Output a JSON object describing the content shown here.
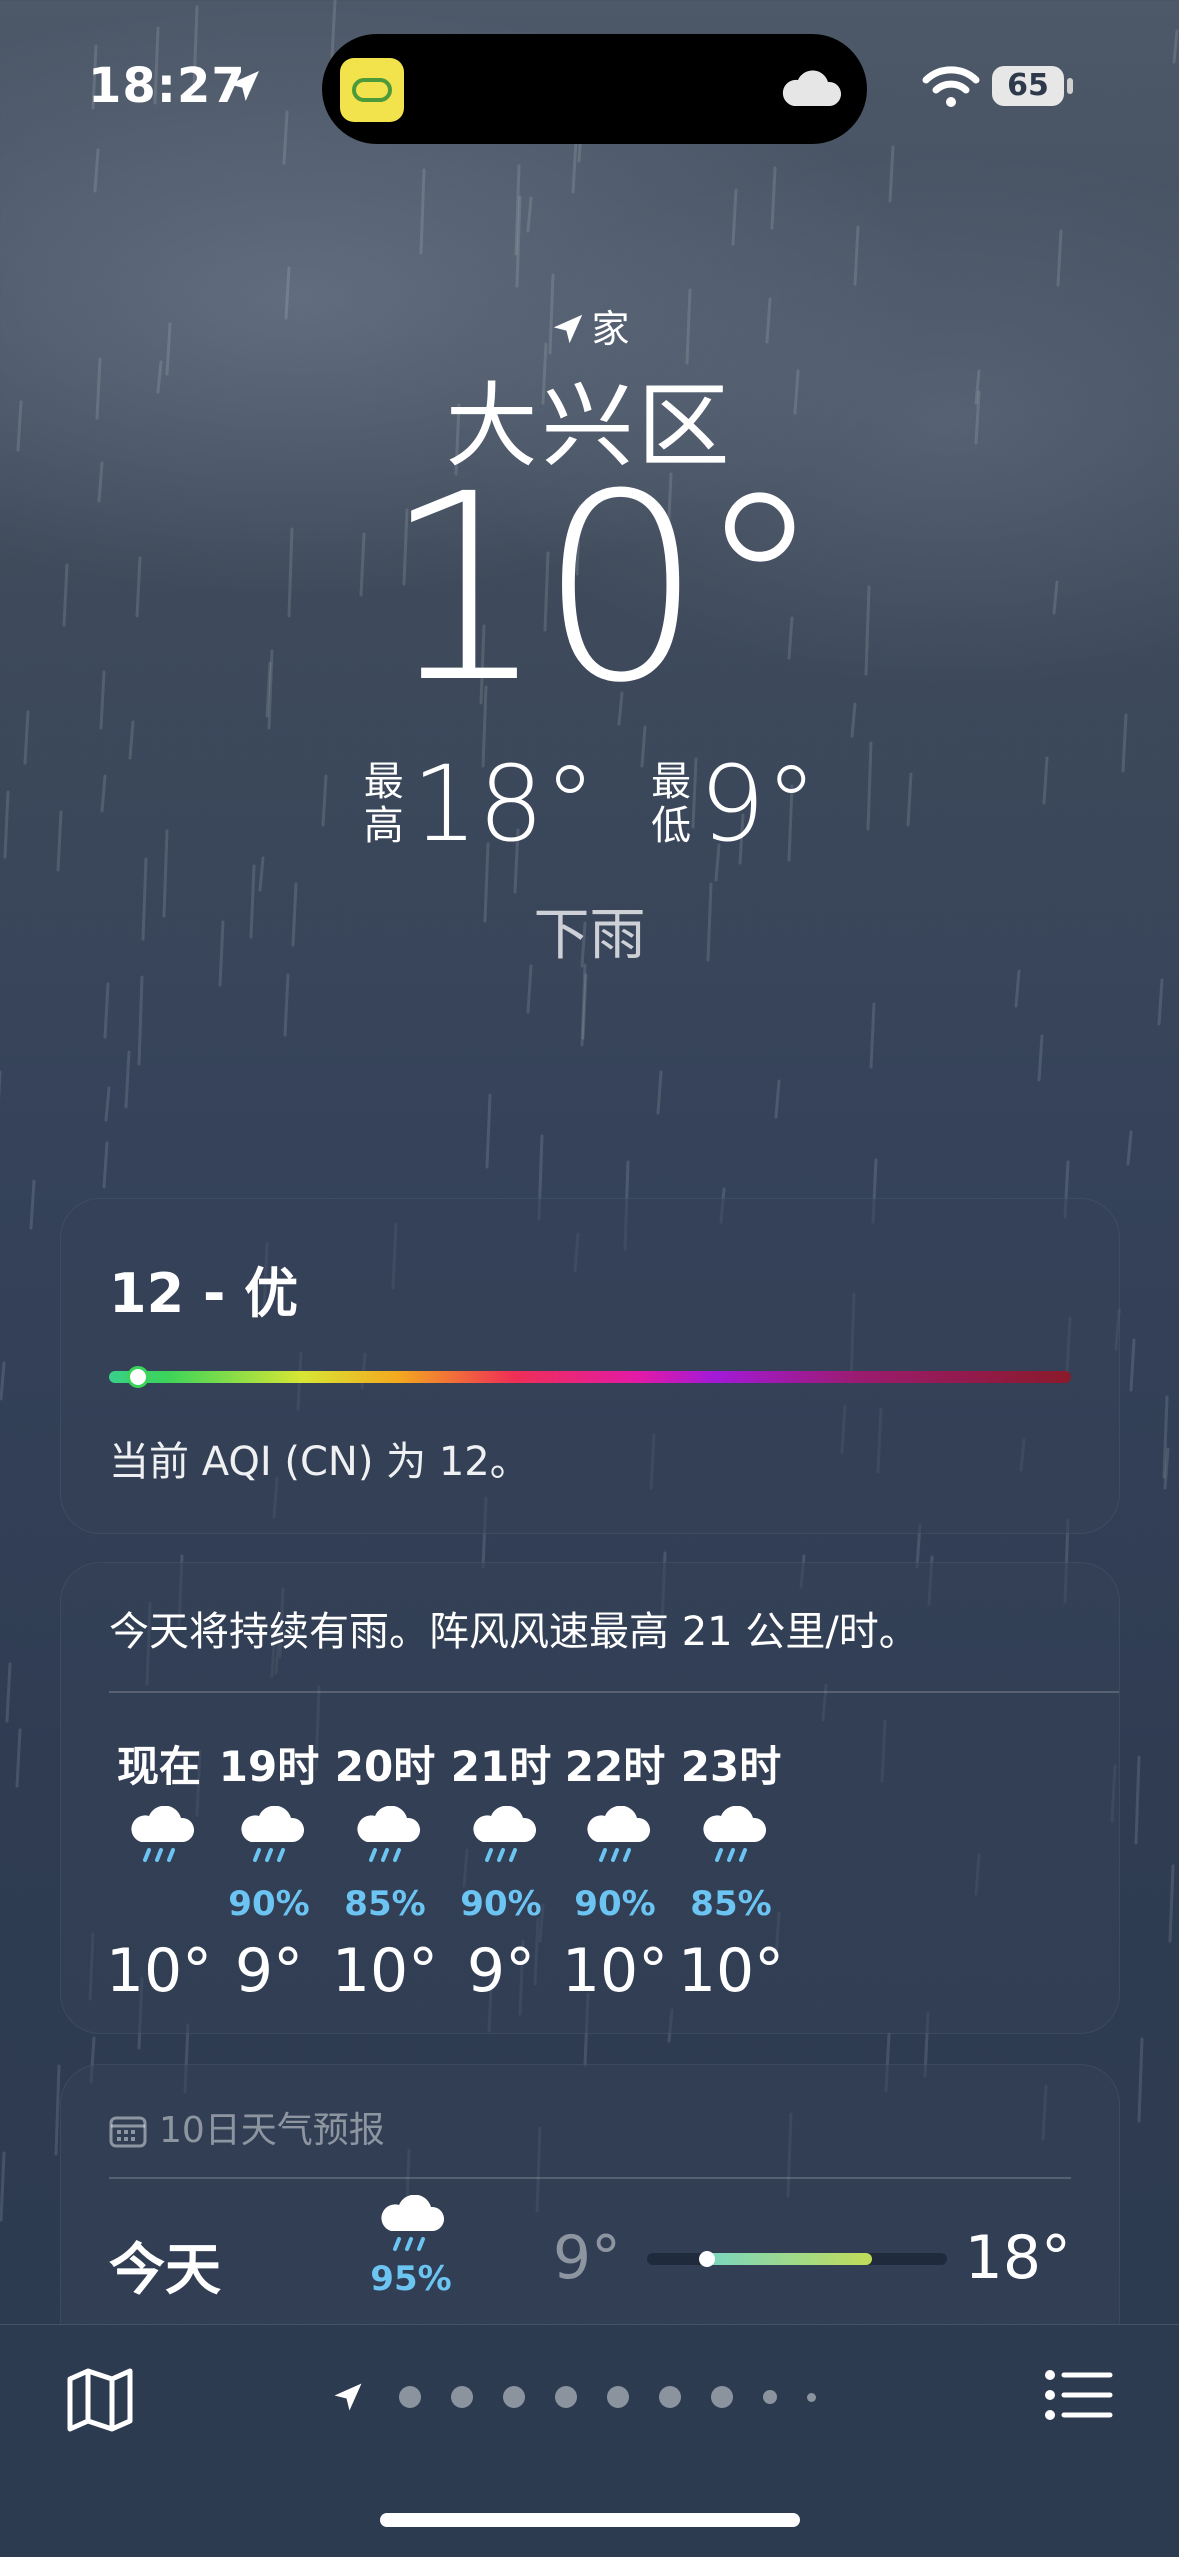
{
  "status_bar": {
    "time": "18:27",
    "battery": "65"
  },
  "location": {
    "label": "家",
    "city": "大兴区"
  },
  "current": {
    "temp": "10°",
    "high_label": "最高",
    "high": "18°",
    "low_label": "最低",
    "low": "9°",
    "condition": "下雨"
  },
  "aqi": {
    "title": "12 - 优",
    "description": "当前 AQI (CN) 为 12。",
    "value_fraction": 0.03
  },
  "hourly": {
    "summary": "今天将持续有雨。阵风风速最高 21 公里/时。",
    "items": [
      {
        "hour": "现在",
        "pct": "",
        "temp": "10°"
      },
      {
        "hour": "19时",
        "pct": "90%",
        "temp": "9°"
      },
      {
        "hour": "20时",
        "pct": "85%",
        "temp": "10°"
      },
      {
        "hour": "21时",
        "pct": "90%",
        "temp": "9°"
      },
      {
        "hour": "22时",
        "pct": "90%",
        "temp": "10°"
      },
      {
        "hour": "23时",
        "pct": "85%",
        "temp": "10°"
      }
    ]
  },
  "daily": {
    "header": "10日天气预报",
    "today": {
      "day": "今天",
      "pct": "95%",
      "low": "9°",
      "high": "18°",
      "range_start": 0.2,
      "range_end": 0.75,
      "current": 0.2
    }
  },
  "icons": {
    "status": [
      "location-arrow-icon",
      "weather-app-icon",
      "cloud-icon",
      "wifi-icon",
      "battery-icon"
    ],
    "toolbar": [
      "map-icon",
      "location-arrow-icon",
      "list-icon"
    ],
    "hourly": "cloud-rain-icon",
    "daily_header": "calendar-icon"
  },
  "colors": {
    "precip": "#6cc4f2",
    "aqi_good": "#3bd45a"
  }
}
